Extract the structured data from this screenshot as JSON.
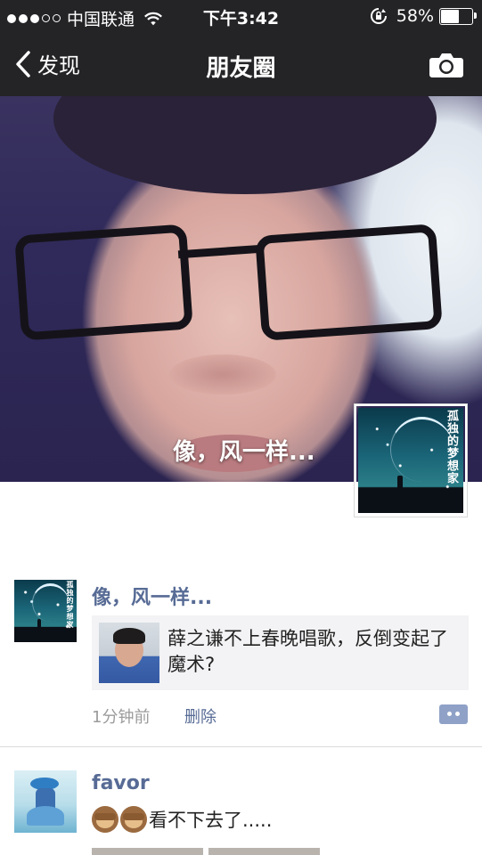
{
  "status_bar": {
    "carrier": "中国联通",
    "time": "下午3:42",
    "battery": "58%",
    "battery_level": 0.58
  },
  "nav": {
    "back_label": "发现",
    "title": "朋友圈"
  },
  "cover": {
    "name": "像，风一样..."
  },
  "profile_avatar": {
    "text": "孤独的梦想家"
  },
  "posts": [
    {
      "author": "像，风一样...",
      "avatar_text": "孤独的梦想家",
      "shared_title": "薛之谦不上春晚唱歌，反倒变起了魔术?",
      "time": "1分钟前",
      "delete_label": "删除"
    },
    {
      "author": "favor",
      "text": "看不下去了.....",
      "emoji": "see-no-evil-monkey"
    }
  ],
  "colors": {
    "nav_bg": "#242427",
    "link": "#576b95",
    "card_bg": "#f3f3f5",
    "meta": "#9b9b9b"
  }
}
